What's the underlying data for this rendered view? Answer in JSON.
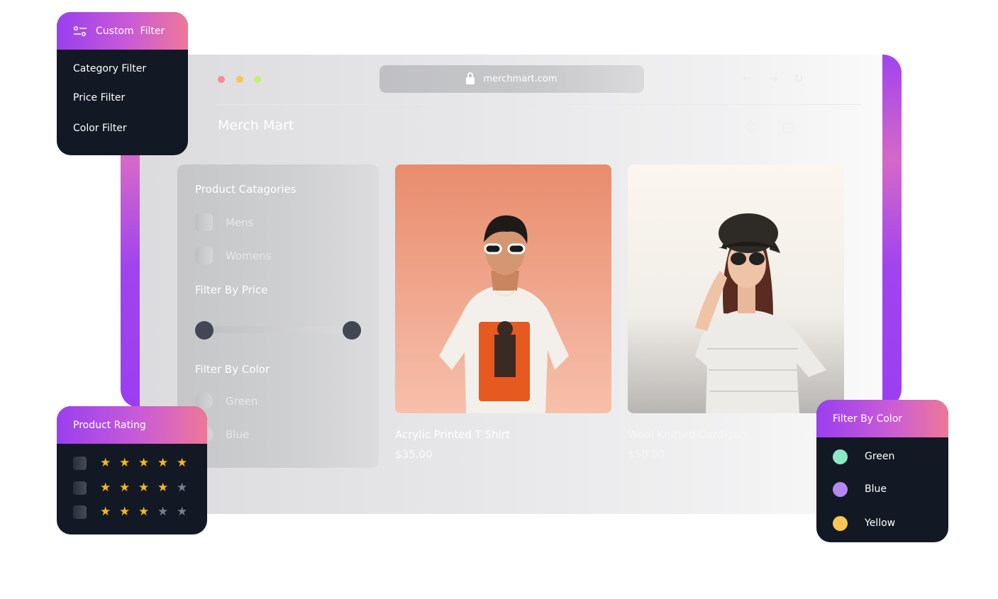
{
  "browser": {
    "url": "merchmart.com",
    "brand": "Merch Mart"
  },
  "sidebar": {
    "categories_title": "Product Catagories",
    "categories": [
      "Mens",
      "Womens"
    ],
    "price_title": "Filter By Price",
    "price_range": {
      "min_fraction": 0.0,
      "max_fraction": 1.0
    },
    "color_title": "Filter By Color",
    "colors": [
      "Green",
      "Blue"
    ]
  },
  "products": [
    {
      "title": "Acrylic Printed T Shirt",
      "price": "$35.00"
    },
    {
      "title": "Wool Knitted Cardigan",
      "price": "$50.00"
    }
  ],
  "custom_filter": {
    "title": "Custom  Filter",
    "items": [
      "Category Filter",
      "Price Filter",
      "Color Filter"
    ]
  },
  "product_rating": {
    "title": "Product Rating",
    "rows": [
      5,
      4,
      3
    ],
    "max_stars": 5,
    "star_color": "#f5b91c",
    "empty_star_color": "#7a7f89"
  },
  "filter_by_color": {
    "title": "Filter By Color",
    "items": [
      {
        "label": "Green",
        "color": "#8ce9c8"
      },
      {
        "label": "Blue",
        "color": "#b487f2"
      },
      {
        "label": "Yellow",
        "color": "#fbc656"
      }
    ]
  },
  "colors": {
    "accent_start": "#9a3ff0",
    "accent_end": "#ee7897",
    "card_bg": "#131924"
  }
}
